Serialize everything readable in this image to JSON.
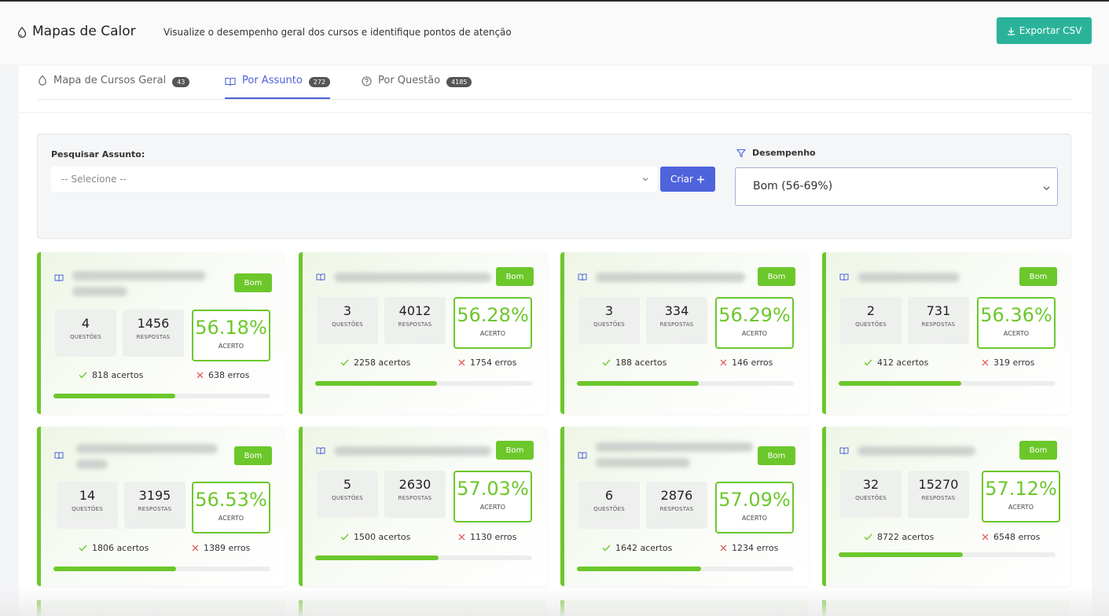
{
  "header": {
    "title": "Mapas de Calor",
    "subtitle": "Visualize o desempenho geral dos cursos e identifique pontos de atenção",
    "export_label": "Exportar CSV"
  },
  "tabs": [
    {
      "label": "Mapa de Cursos Geral",
      "count": "43",
      "icon": "drop-icon"
    },
    {
      "label": "Por Assunto",
      "count": "272",
      "icon": "book-icon"
    },
    {
      "label": "Por Questão",
      "count": "4185",
      "icon": "question-icon"
    }
  ],
  "filters": {
    "subject_label": "Pesquisar Assunto:",
    "subject_placeholder": "-- Selecione --",
    "create_label": "Criar",
    "performance_label": "Desempenho",
    "performance_value": "Bom (56-69%)"
  },
  "colors": {
    "accent_green": "#6cc72b",
    "export_teal": "#2bb39a",
    "primary_blue": "#4f63dd"
  },
  "cards": [
    {
      "tag": "Bom",
      "questions": "4",
      "questions_label": "QUESTÕES",
      "responses": "1456",
      "responses_label": "RESPOSTAS",
      "percent": "56.18%",
      "percent_label": "ACERTO",
      "hits": "818 acertos",
      "errors": "638 erros",
      "progress": 0.5618
    },
    {
      "tag": "Bom",
      "questions": "3",
      "questions_label": "QUESTÕES",
      "responses": "4012",
      "responses_label": "RESPOSTAS",
      "percent": "56.28%",
      "percent_label": "ACERTO",
      "hits": "2258 acertos",
      "errors": "1754 erros",
      "progress": 0.5628
    },
    {
      "tag": "Bom",
      "questions": "3",
      "questions_label": "QUESTÕES",
      "responses": "334",
      "responses_label": "RESPOSTAS",
      "percent": "56.29%",
      "percent_label": "ACERTO",
      "hits": "188 acertos",
      "errors": "146 erros",
      "progress": 0.5629
    },
    {
      "tag": "Bom",
      "questions": "2",
      "questions_label": "QUESTÕES",
      "responses": "731",
      "responses_label": "RESPOSTAS",
      "percent": "56.36%",
      "percent_label": "ACERTO",
      "hits": "412 acertos",
      "errors": "319 erros",
      "progress": 0.5636
    },
    {
      "tag": "Bom",
      "questions": "14",
      "questions_label": "QUESTÕES",
      "responses": "3195",
      "responses_label": "RESPOSTAS",
      "percent": "56.53%",
      "percent_label": "ACERTO",
      "hits": "1806 acertos",
      "errors": "1389 erros",
      "progress": 0.5653
    },
    {
      "tag": "Bom",
      "questions": "5",
      "questions_label": "QUESTÕES",
      "responses": "2630",
      "responses_label": "RESPOSTAS",
      "percent": "57.03%",
      "percent_label": "ACERTO",
      "hits": "1500 acertos",
      "errors": "1130 erros",
      "progress": 0.5703
    },
    {
      "tag": "Bom",
      "questions": "6",
      "questions_label": "QUESTÕES",
      "responses": "2876",
      "responses_label": "RESPOSTAS",
      "percent": "57.09%",
      "percent_label": "ACERTO",
      "hits": "1642 acertos",
      "errors": "1234 erros",
      "progress": 0.5709
    },
    {
      "tag": "Bom",
      "questions": "32",
      "questions_label": "QUESTÕES",
      "responses": "15270",
      "responses_label": "RESPOSTAS",
      "percent": "57.12%",
      "percent_label": "ACERTO",
      "hits": "8722 acertos",
      "errors": "6548 erros",
      "progress": 0.5712
    }
  ]
}
